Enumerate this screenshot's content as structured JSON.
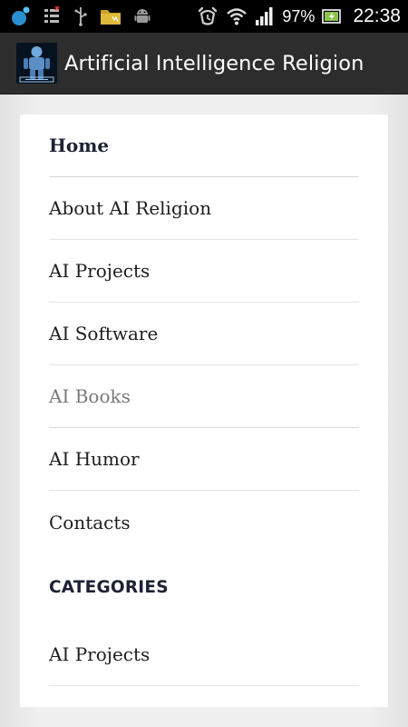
{
  "status_bar": {
    "battery_percent": "97%",
    "time": "22:38",
    "icons": [
      "bubble-notification-icon",
      "tasks-icon",
      "usb-icon",
      "folder-icon",
      "android-debug-icon",
      "alarm-icon",
      "wifi-icon",
      "signal-icon",
      "battery-charging-icon"
    ]
  },
  "action_bar": {
    "title": "Artificial Intelligence Religion",
    "logo_icon": "robot-logo-icon"
  },
  "menu": {
    "items": [
      {
        "label": "Home"
      },
      {
        "label": "About AI Religion"
      },
      {
        "label": "AI Projects"
      },
      {
        "label": "AI Software"
      },
      {
        "label": "AI Books"
      },
      {
        "label": "AI Humor"
      },
      {
        "label": "Contacts"
      }
    ]
  },
  "categories": {
    "heading": "CATEGORIES",
    "items": [
      {
        "label": "AI Projects"
      }
    ]
  },
  "colors": {
    "status_bar_bg": "#000000",
    "action_bar_bg": "#2d2d2d",
    "heading_text": "#1c2234",
    "dim_text": "#7a7a7a",
    "battery_green": "#8bc34a"
  }
}
